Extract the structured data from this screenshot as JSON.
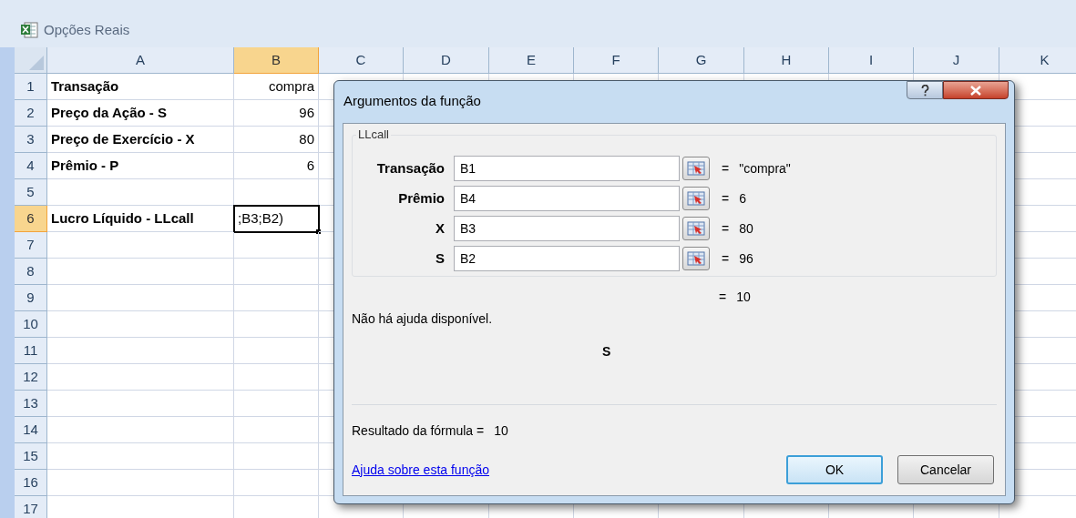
{
  "window": {
    "title": "Opções Reais"
  },
  "columns": [
    {
      "label": "A",
      "selected": false
    },
    {
      "label": "B",
      "selected": true
    },
    {
      "label": "C",
      "selected": false
    },
    {
      "label": "D",
      "selected": false
    },
    {
      "label": "E",
      "selected": false
    },
    {
      "label": "F",
      "selected": false
    },
    {
      "label": "G",
      "selected": false
    },
    {
      "label": "H",
      "selected": false
    },
    {
      "label": "I",
      "selected": false
    },
    {
      "label": "J",
      "selected": false
    },
    {
      "label": "K",
      "selected": false
    }
  ],
  "rows": [
    {
      "number": "1",
      "selected": false,
      "label": "Transação",
      "value": "compra"
    },
    {
      "number": "2",
      "selected": false,
      "label": "Preço da Ação - S",
      "value": "96"
    },
    {
      "number": "3",
      "selected": false,
      "label": "Preço de Exercício - X",
      "value": "80"
    },
    {
      "number": "4",
      "selected": false,
      "label": "Prêmio - P",
      "value": "6"
    },
    {
      "number": "5",
      "selected": false
    },
    {
      "number": "6",
      "selected": true,
      "label": "Lucro Líquido - LLcall",
      "value": ";B3;B2)"
    },
    {
      "number": "7",
      "selected": false
    },
    {
      "number": "8",
      "selected": false
    },
    {
      "number": "9",
      "selected": false
    },
    {
      "number": "10",
      "selected": false
    },
    {
      "number": "11",
      "selected": false
    },
    {
      "number": "12",
      "selected": false
    },
    {
      "number": "13",
      "selected": false
    },
    {
      "number": "14",
      "selected": false
    },
    {
      "number": "15",
      "selected": false
    },
    {
      "number": "16",
      "selected": false
    },
    {
      "number": "17",
      "selected": false
    }
  ],
  "dialog": {
    "title": "Argumentos da função",
    "group": "LLcall",
    "arguments": [
      {
        "label": "Transação",
        "value": "B1",
        "equals": "=",
        "result": "\"compra\""
      },
      {
        "label": "Prêmio",
        "value": "B4",
        "equals": "=",
        "result": "6"
      },
      {
        "label": "X",
        "value": "B3",
        "equals": "=",
        "result": "80"
      },
      {
        "label": "S",
        "value": "B2",
        "equals": "=",
        "result": "96"
      }
    ],
    "function_result": {
      "equals": "=",
      "value": "10"
    },
    "description": "Não há ajuda disponível.",
    "current_argument": "S",
    "formula_result": {
      "label": "Resultado da fórmula =",
      "value": "10"
    },
    "help_link": "Ajuda sobre esta função",
    "buttons": [
      {
        "label": "OK",
        "default": true
      },
      {
        "label": "Cancelar",
        "default": false
      }
    ]
  }
}
